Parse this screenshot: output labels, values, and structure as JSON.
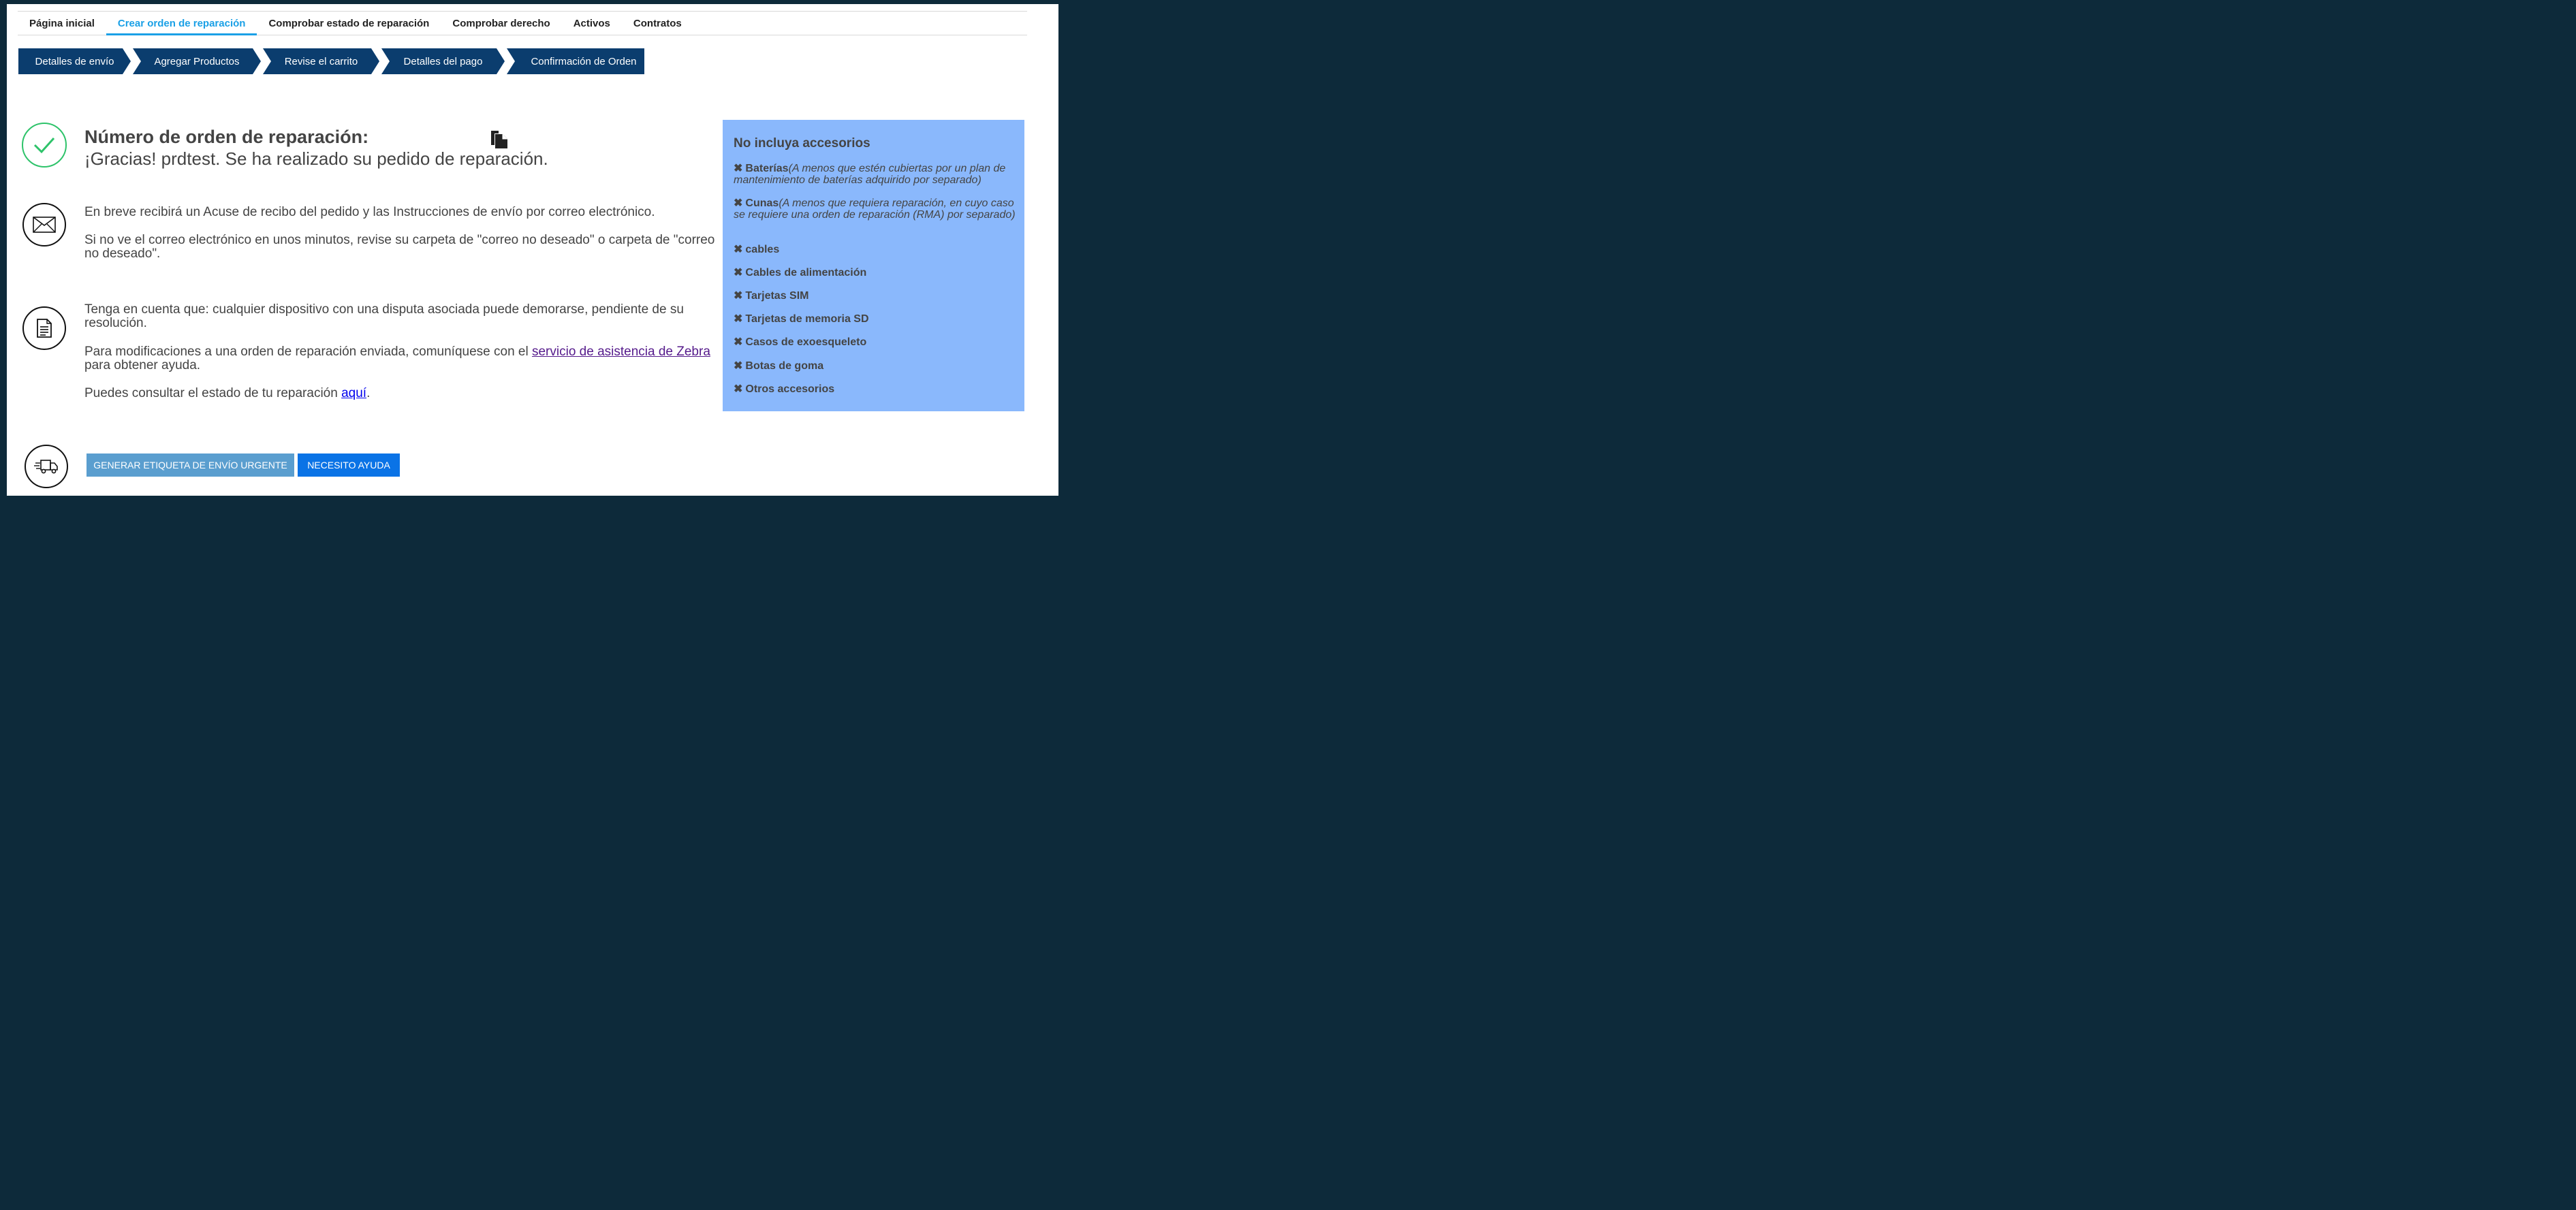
{
  "nav": {
    "items": [
      {
        "label": "Página inicial",
        "active": false
      },
      {
        "label": "Crear orden de reparación",
        "active": true
      },
      {
        "label": "Comprobar estado de reparación",
        "active": false
      },
      {
        "label": "Comprobar derecho",
        "active": false
      },
      {
        "label": "Activos",
        "active": false
      },
      {
        "label": "Contratos",
        "active": false
      }
    ]
  },
  "steps": [
    "Detalles de envío",
    "Agregar Productos",
    "Revise el carrito",
    "Detalles del pago",
    "Confirmación de Orden"
  ],
  "confirmation": {
    "title": "Número de orden de reparación:",
    "subtitle": "¡Gracias! prdtest. Se ha realizado su pedido de reparación."
  },
  "email": {
    "line1": "En breve recibirá un Acuse de recibo del pedido y las Instrucciones de envío por correo electrónico.",
    "line2": "Si no ve el correo electrónico en unos minutos, revise su carpeta de \"correo no deseado\" o carpeta de \"correo no deseado\"."
  },
  "notes": {
    "dispute": "Tenga en cuenta que: cualquier dispositivo con una disputa asociada puede demorarse, pendiente de su resolución.",
    "modify_before": "Para modificaciones a una orden de reparación enviada, comuníquese con el ",
    "modify_link": " servicio de asistencia de Zebra",
    "modify_after": " para obtener ayuda.",
    "status_before": "Puedes consultar el estado de tu reparación ",
    "status_link": "aquí",
    "status_after": "."
  },
  "panel": {
    "title": "No incluya accesorios",
    "x_glyph": "✖",
    "items": [
      {
        "label": "Baterías",
        "note": "(A menos que estén cubiertas por un plan de mantenimiento de baterías adquirido por separado)"
      },
      {
        "label": "Cunas",
        "note": "(A menos que requiera reparación, en cuyo caso se requiere una orden de reparación (RMA) por separado)"
      },
      {
        "label": "cables",
        "note": ""
      },
      {
        "label": "Cables de alimentación",
        "note": ""
      },
      {
        "label": "Tarjetas SIM",
        "note": ""
      },
      {
        "label": "Tarjetas de memoria SD",
        "note": ""
      },
      {
        "label": "Casos de exoesqueleto",
        "note": ""
      },
      {
        "label": "Botas de goma",
        "note": ""
      },
      {
        "label": "Otros accesorios",
        "note": ""
      }
    ]
  },
  "buttons": {
    "urgent_label": "GENERAR ETIQUETA DE ENVÍO URGENTE",
    "help_label": "NECESITO AYUDA"
  },
  "colors": {
    "nav_active": "#1aa0e6",
    "step_bg": "#0b3d6e",
    "panel_bg": "#8ab8fc",
    "check_green": "#2ec36a",
    "btn_urgent": "#5a9ecf",
    "btn_help": "#0a73e6"
  },
  "icons": [
    "check-icon",
    "envelope-icon",
    "document-icon",
    "delivery-truck-icon",
    "copy-icon"
  ]
}
